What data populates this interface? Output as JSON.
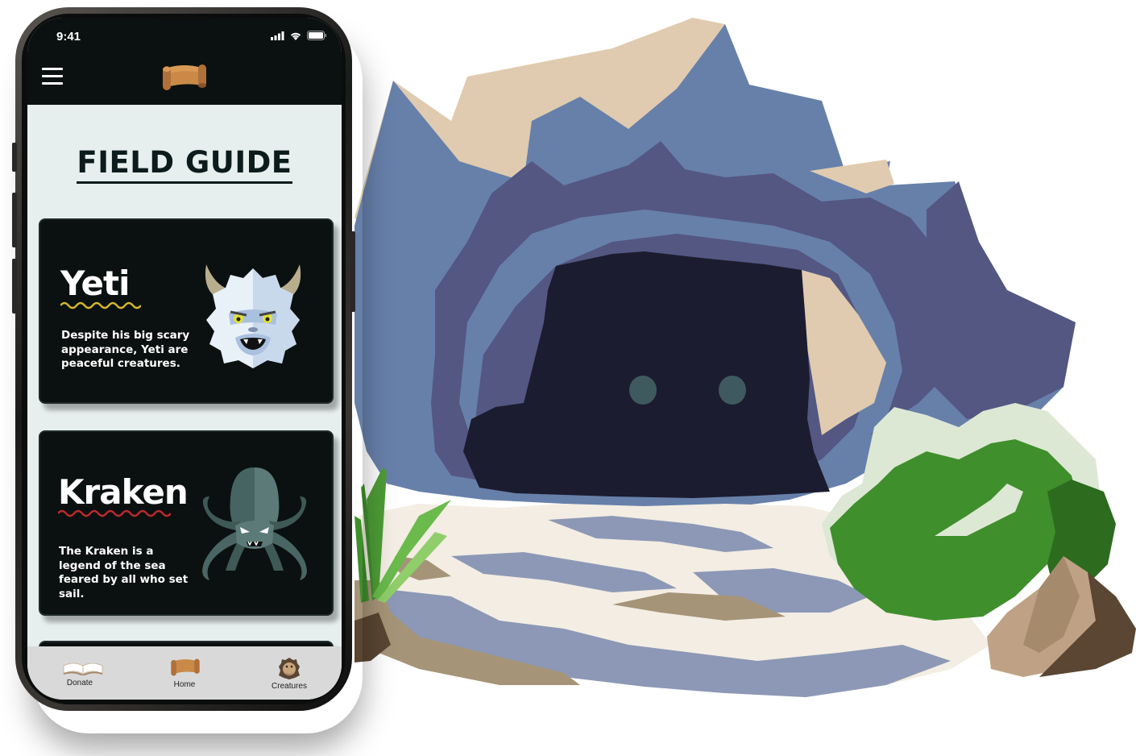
{
  "status_bar": {
    "time": "9:41"
  },
  "header": {
    "menu_icon": "hamburger-menu-icon",
    "logo_icon": "scroll-icon"
  },
  "page": {
    "title": "FIELD GUIDE"
  },
  "cards": [
    {
      "name": "Yeti",
      "description": "Despite his big scary appearance, Yeti are peaceful creatures.",
      "accent": "#d4b72c",
      "icon": "yeti-icon"
    },
    {
      "name": "Kraken",
      "description": "The Kraken is a legend of the sea feared by all who set sail.",
      "accent": "#c0292c",
      "icon": "kraken-icon"
    }
  ],
  "tabbar": {
    "items": [
      {
        "label": "Donate",
        "icon": "open-book-icon"
      },
      {
        "label": "Home",
        "icon": "scroll-icon"
      },
      {
        "label": "Creatures",
        "icon": "bigfoot-icon"
      }
    ]
  },
  "colors": {
    "screen_bg": "#e6efee",
    "card_bg": "#0b1110",
    "topbar_bg": "#0b1110",
    "tabbar_bg": "#d9d9d9"
  }
}
